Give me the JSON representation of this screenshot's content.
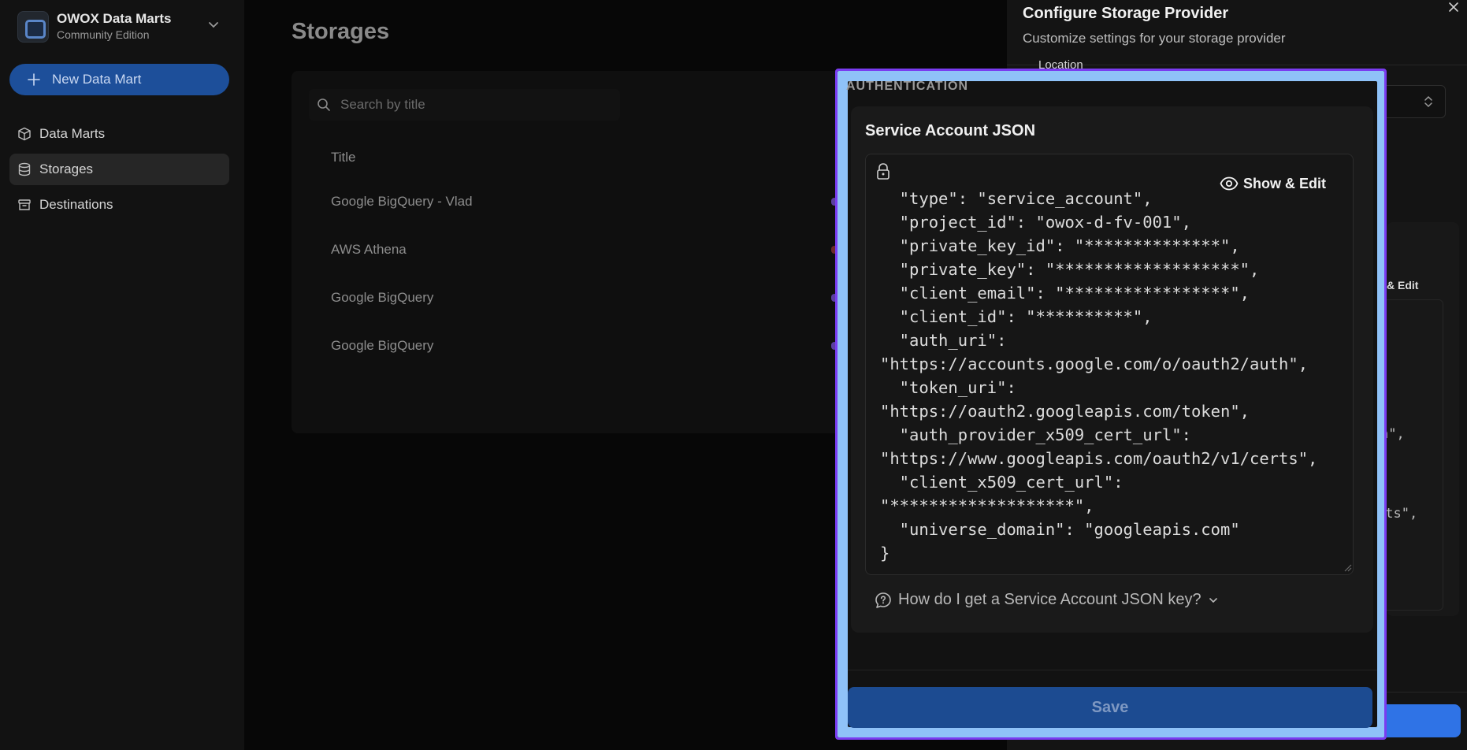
{
  "sidebar": {
    "brand_name": "OWOX Data Marts",
    "brand_sub": "Community Edition",
    "new_button": "New Data Mart",
    "items": [
      {
        "label": "Data Marts",
        "icon": "cube-icon"
      },
      {
        "label": "Storages",
        "icon": "database-icon",
        "active": true
      },
      {
        "label": "Destinations",
        "icon": "archive-icon"
      }
    ]
  },
  "main": {
    "title": "Storages",
    "search_placeholder": "Search by title",
    "column_title": "Title",
    "rows": [
      "Google BigQuery - Vlad",
      "AWS Athena",
      "Google BigQuery",
      "Google BigQuery"
    ]
  },
  "drawer": {
    "title": "Configure Storage Provider",
    "subtitle": "Customize settings for your storage provider",
    "location_label": "Location",
    "bg_show_edit": "& Edit",
    "bg_frag_1": "h\",",
    "bg_frag_2": "rts\","
  },
  "modal": {
    "section_label": "AUTHENTICATION",
    "field_title": "Service Account JSON",
    "show_edit_label": "Show & Edit",
    "json_value": "  \"type\": \"service_account\",\n  \"project_id\": \"owox-d-fv-001\",\n  \"private_key_id\": \"**************\",\n  \"private_key\": \"*******************\",\n  \"client_email\": \"*****************\",\n  \"client_id\": \"**********\",\n  \"auth_uri\":\n\"https://accounts.google.com/o/oauth2/auth\",\n  \"token_uri\":\n\"https://oauth2.googleapis.com/token\",\n  \"auth_provider_x509_cert_url\":\n\"https://www.googleapis.com/oauth2/v1/certs\",\n  \"client_x509_cert_url\":\n\"*******************\",\n  \"universe_domain\": \"googleapis.com\"\n}",
    "help_text": "How do I get a Service Account JSON key?",
    "save_label": "Save"
  },
  "colors": {
    "accent": "#2f73e6",
    "highlight_border": "#7a3cf0",
    "highlight_fill": "#8fc2f8"
  }
}
